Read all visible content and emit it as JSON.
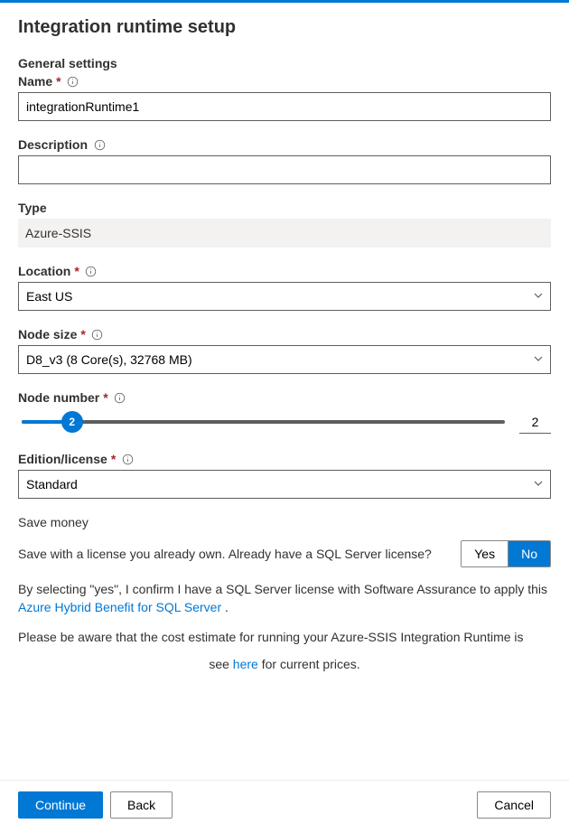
{
  "title": "Integration runtime setup",
  "sectionLabel": "General settings",
  "fields": {
    "name": {
      "label": "Name",
      "value": "integrationRuntime1"
    },
    "description": {
      "label": "Description",
      "value": ""
    },
    "type": {
      "label": "Type",
      "value": "Azure-SSIS"
    },
    "location": {
      "label": "Location",
      "selected": "East US"
    },
    "nodeSize": {
      "label": "Node size",
      "selected": "D8_v3 (8 Core(s), 32768 MB)"
    },
    "nodeNumber": {
      "label": "Node number",
      "value": "2"
    },
    "edition": {
      "label": "Edition/license",
      "selected": "Standard"
    }
  },
  "saveMoney": {
    "title": "Save money",
    "question": "Save with a license you already own. Already have a SQL Server license?",
    "options": {
      "yes": "Yes",
      "no": "No"
    },
    "selected": "no",
    "confirmPrefix": "By selecting \"yes\", I confirm I have a SQL Server license with Software Assurance to apply this ",
    "confirmLink": "Azure Hybrid Benefit for SQL Server",
    "confirmSuffix": " .",
    "costPrefix": "Please be aware that the cost estimate for running your Azure-SSIS Integration Runtime is",
    "costMid": "see ",
    "costLink": "here",
    "costSuffix": " for current prices."
  },
  "footer": {
    "continue": "Continue",
    "back": "Back",
    "cancel": "Cancel"
  }
}
